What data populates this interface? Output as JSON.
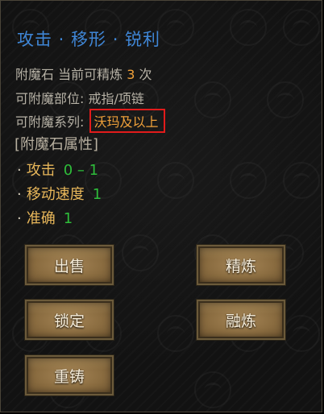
{
  "item": {
    "title": "攻击 · 移形 · 锐利",
    "refine_prefix": "附魔石  当前可精炼 ",
    "refine_count": "3",
    "refine_suffix": " 次",
    "slot_label": "可附魔部位: 戒指/项链",
    "series_label": "可附魔系列: ",
    "series_value": "沃玛及以上"
  },
  "attributes": {
    "header": "[附魔石属性]",
    "list": [
      {
        "name": "攻击",
        "value": "0 – 1"
      },
      {
        "name": "移动速度",
        "value": "1"
      },
      {
        "name": "准确",
        "value": "1"
      }
    ]
  },
  "buttons": {
    "sell": "出售",
    "refine": "精炼",
    "lock": "锁定",
    "fuse": "融炼",
    "recast": "重铸"
  },
  "colors": {
    "title": "#3f86d6",
    "highlight_border": "#e21b1b",
    "value_orange": "#f0a13a",
    "stat_green": "#2ebd3a",
    "stat_name": "#e8b75a"
  }
}
